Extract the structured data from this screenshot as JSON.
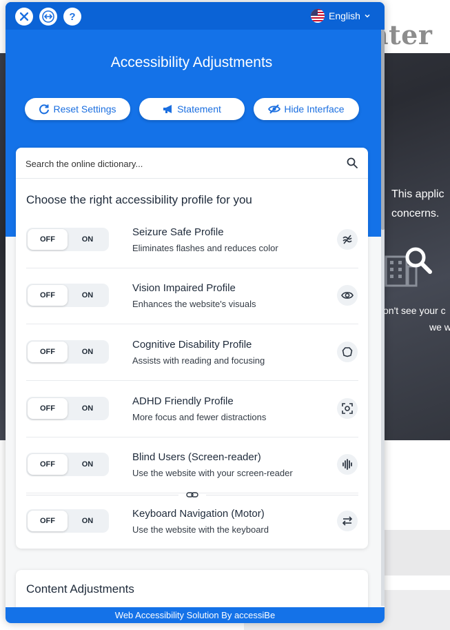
{
  "background": {
    "logo_text": "nter",
    "hero_text_line1": "This applic",
    "hero_text_line2": "concerns.",
    "hero_small_line1": "on't see your c",
    "hero_small_line2": "we w"
  },
  "widget": {
    "topbar": {
      "language": "English"
    },
    "title": "Accessibility Adjustments",
    "actions": {
      "reset": "Reset Settings",
      "statement": "Statement",
      "hide": "Hide Interface"
    },
    "search": {
      "placeholder": "Search the online dictionary..."
    },
    "profiles_heading": "Choose the right accessibility profile for you",
    "toggle": {
      "off": "OFF",
      "on": "ON"
    },
    "profiles": [
      {
        "title": "Seizure Safe Profile",
        "description": "Eliminates flashes and reduces color",
        "icon": "seizure-icon"
      },
      {
        "title": "Vision Impaired Profile",
        "description": "Enhances the website's visuals",
        "icon": "eye-icon"
      },
      {
        "title": "Cognitive Disability Profile",
        "description": "Assists with reading and focusing",
        "icon": "brain-icon"
      },
      {
        "title": "ADHD Friendly Profile",
        "description": "More focus and fewer distractions",
        "icon": "focus-icon"
      },
      {
        "title": "Blind Users (Screen-reader)",
        "description": "Use the website with your screen-reader",
        "icon": "audio-wave-icon"
      },
      {
        "title": "Keyboard Navigation (Motor)",
        "description": "Use the website with the keyboard",
        "icon": "arrows-icon"
      }
    ],
    "content_heading": "Content Adjustments",
    "footer": "Web Accessibility Solution By accessiBe"
  },
  "colors": {
    "primary": "#1472e8",
    "topbar": "#0b63d6",
    "panel_bg": "#f6f7f8"
  }
}
